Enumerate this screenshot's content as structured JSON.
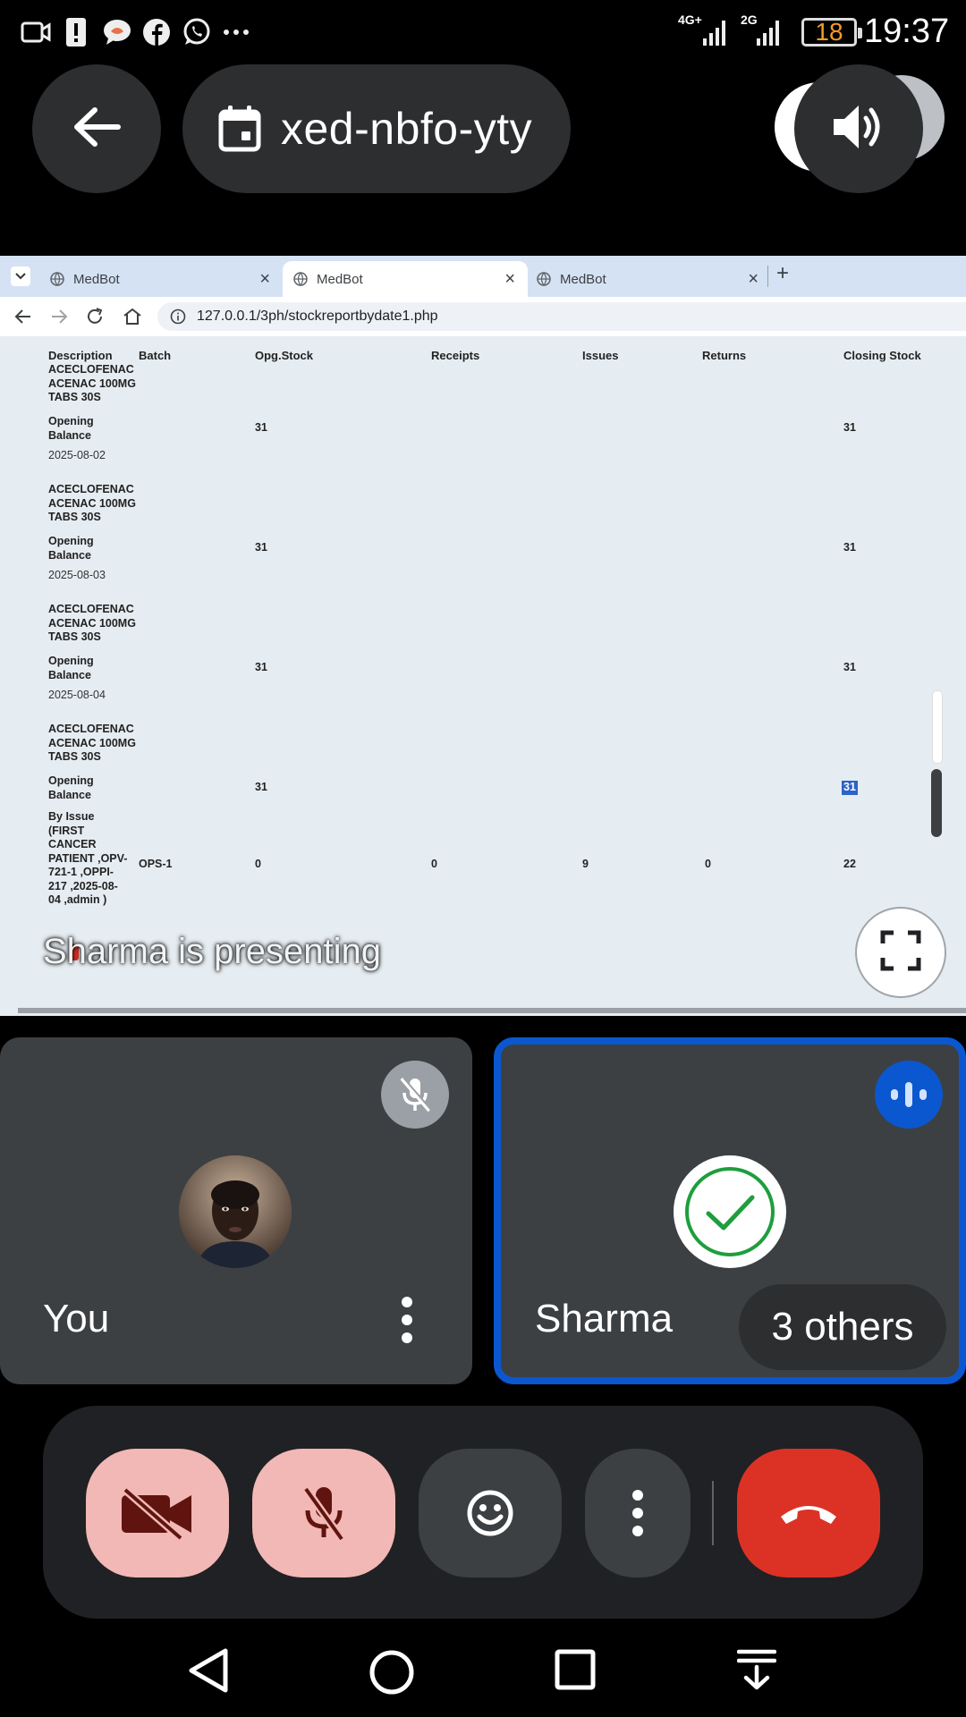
{
  "status_bar": {
    "left_icons": [
      "video-camera-icon",
      "sim-alert-icon",
      "messenger-icon",
      "facebook-icon",
      "whatsapp-icon",
      "more-dots-icon"
    ],
    "network_4g": "4G+",
    "network_2g": "2G",
    "battery": "18",
    "time": "19:37",
    "battery_color": "#f39a2b"
  },
  "meet_header": {
    "meeting_code": "xed-nbfo-yty",
    "back_icon": "back-arrow-icon",
    "calendar_icon": "calendar-icon",
    "speaker_icon": "speaker-icon"
  },
  "browser": {
    "tabs": [
      {
        "title": "MedBot",
        "active": false
      },
      {
        "title": "MedBot",
        "active": true
      },
      {
        "title": "MedBot",
        "active": false
      }
    ],
    "new_tab": "+",
    "url": "127.0.0.1/3ph/stockreportbydate1.php"
  },
  "report": {
    "columns": [
      "Description",
      "Batch",
      "Opg.Stock",
      "Receipts",
      "Issues",
      "Returns",
      "Closing Stock"
    ],
    "rows": [
      {
        "type": "product",
        "description": "ACECLOFENAC ACENAC 100MG TABS 30S"
      },
      {
        "type": "opening",
        "description": "Opening Balance",
        "opg_stock": "31",
        "closing_stock": "31"
      },
      {
        "type": "date",
        "date": "2025-08-02"
      },
      {
        "type": "product",
        "description": "ACECLOFENAC ACENAC 100MG TABS 30S"
      },
      {
        "type": "opening",
        "description": "Opening Balance",
        "opg_stock": "31",
        "closing_stock": "31"
      },
      {
        "type": "date",
        "date": "2025-08-03"
      },
      {
        "type": "product",
        "description": "ACECLOFENAC ACENAC 100MG TABS 30S"
      },
      {
        "type": "opening",
        "description": "Opening Balance",
        "opg_stock": "31",
        "closing_stock": "31"
      },
      {
        "type": "date",
        "date": "2025-08-04"
      },
      {
        "type": "product",
        "description": "ACECLOFENAC ACENAC 100MG TABS 30S"
      },
      {
        "type": "opening",
        "description": "Opening Balance",
        "opg_stock": "31",
        "closing_stock": "31"
      },
      {
        "type": "issue",
        "description": "By Issue (FIRST CANCER PATIENT ,OPV-721-1 ,OPPI-217 ,2025-08-04 ,admin )",
        "batch": "OPS-1",
        "opg_stock": "0",
        "receipts": "0",
        "issues": "9",
        "returns": "0",
        "closing_stock": "22"
      }
    ]
  },
  "presenting_label": "Sharma is presenting",
  "tiles": {
    "you": {
      "name": "You",
      "mic_state": "muted"
    },
    "sharma": {
      "name": "Sharma",
      "others": "3 others",
      "speaking_color": "#0b57d0"
    }
  },
  "controls": {
    "camera": "camera-off",
    "mic": "mic-off",
    "reactions": "emoji",
    "more": "more-options",
    "end_call": "end-call",
    "muted_bg": "#f2b8b5",
    "end_call_bg": "#dc3226"
  }
}
